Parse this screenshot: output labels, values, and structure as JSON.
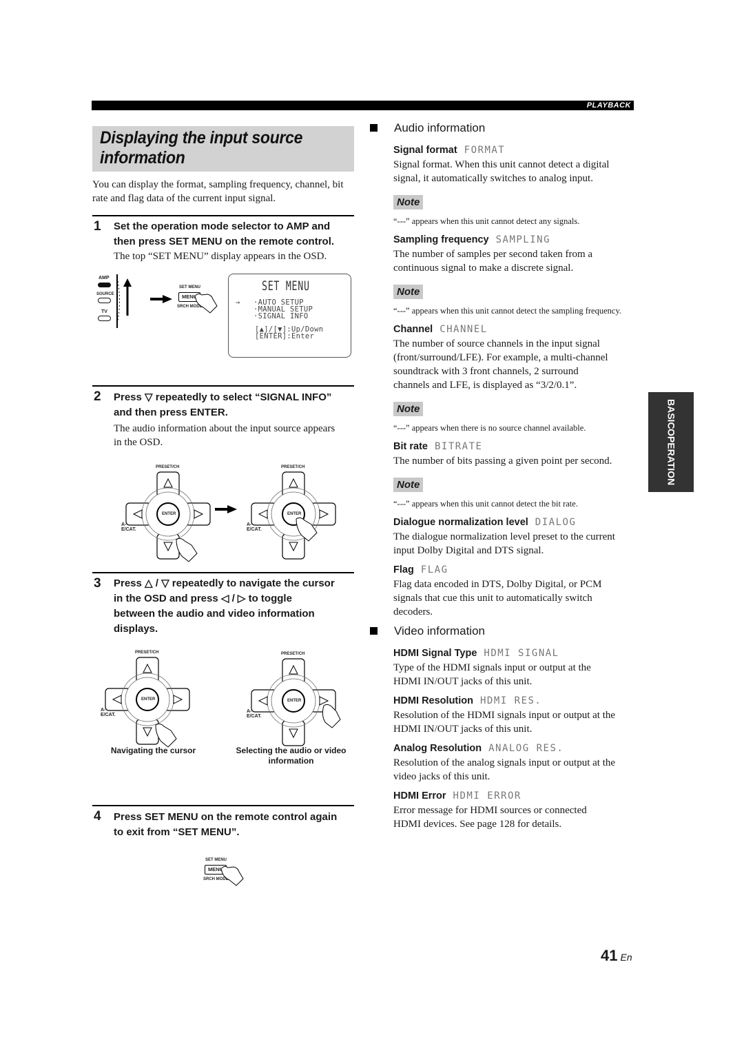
{
  "header": {
    "section_tag": "PLAYBACK"
  },
  "left": {
    "title_line1": "Displaying the input source",
    "title_line2": "information",
    "intro": "You can display the format, sampling frequency, channel, bit rate and flag data of the current input signal.",
    "steps": [
      {
        "num": "1",
        "head_lines": [
          "Set the operation mode selector to AMP and",
          "then press SET MENU on the remote control."
        ],
        "desc_lines": [
          "The top “SET MENU” display appears in the OSD."
        ]
      },
      {
        "num": "2",
        "head_lines": [
          "Press ▽ repeatedly to select “SIGNAL INFO”",
          "and then press ENTER."
        ],
        "desc_lines": [
          "The audio information about the input source appears",
          "in the OSD."
        ]
      },
      {
        "num": "3",
        "head_lines": [
          "Press △ / ▽ repeatedly to navigate the cursor",
          "in the OSD and press ◁ / ▷ to toggle",
          "between the audio and video information",
          "displays."
        ],
        "desc_lines": []
      },
      {
        "num": "4",
        "head_lines": [
          "Press SET MENU on the remote control again",
          "to exit from “SET MENU”."
        ],
        "desc_lines": []
      }
    ],
    "remote": {
      "selector_labels": [
        "AMP",
        "SOURCE",
        "TV"
      ],
      "set_menu_label": "SET MENU",
      "menu_button": "MENU",
      "srch_mode_label": "SRCH MODE",
      "preset_label": "PRESET/CH",
      "enter_label": "ENTER",
      "ae_cat_label": "A-E/CAT."
    },
    "osd": {
      "title": "SET MENU",
      "cursor": "→",
      "items": [
        "·AUTO SETUP",
        "·MANUAL SETUP",
        "·SIGNAL INFO"
      ],
      "help": [
        "[▲]/[▼]:Up/Down",
        "[ENTER]:Enter"
      ]
    },
    "captions": [
      "Navigating the cursor",
      "Selecting the audio or video information"
    ]
  },
  "right": {
    "audio_heading": "Audio information",
    "audio_items": [
      {
        "label": "Signal format",
        "lcd": "FORMAT",
        "desc_lines": [
          "Signal format. When this unit cannot detect a digital",
          "signal, it automatically switches to analog input."
        ],
        "note": "“---” appears when this unit cannot detect any signals."
      },
      {
        "label": "Sampling frequency",
        "lcd": "SAMPLING",
        "desc_lines": [
          "The number of samples per second taken from a",
          "continuous signal to make a discrete signal."
        ],
        "note": "“---” appears when this unit cannot detect the sampling frequency."
      },
      {
        "label": "Channel",
        "lcd": "CHANNEL",
        "desc_lines": [
          "The number of source channels in the input signal",
          "(front/surround/LFE). For example, a multi-channel",
          "soundtrack with 3 front channels, 2 surround",
          "channels and LFE, is displayed as “3/2/0.1”."
        ],
        "note": "“---” appears when there is no source channel available."
      },
      {
        "label": "Bit rate",
        "lcd": "BITRATE",
        "desc_lines": [
          "The number of bits passing a given point per second."
        ],
        "note": "“---” appears when this unit cannot detect the bit rate."
      },
      {
        "label": "Dialogue normalization level",
        "lcd": "DIALOG",
        "desc_lines": [
          "The dialogue normalization level preset to the current",
          "input Dolby Digital and DTS signal."
        ]
      },
      {
        "label": "Flag",
        "lcd": "FLAG",
        "desc_lines": [
          "Flag data encoded in DTS, Dolby Digital, or PCM",
          "signals that cue this unit to automatically switch",
          "decoders."
        ]
      }
    ],
    "note_label": "Note",
    "video_heading": "Video information",
    "video_items": [
      {
        "label": "HDMI Signal Type",
        "lcd": "HDMI SIGNAL",
        "desc_lines": [
          "Type of the HDMI signals input or output at the",
          "HDMI IN/OUT jacks of this unit."
        ]
      },
      {
        "label": "HDMI Resolution",
        "lcd": "HDMI RES.",
        "desc_lines": [
          "Resolution of the HDMI signals input or output at the",
          "HDMI IN/OUT jacks of this unit."
        ]
      },
      {
        "label": "Analog Resolution",
        "lcd": "ANALOG RES.",
        "desc_lines": [
          "Resolution of the analog signals input or output at the",
          "video jacks of this unit."
        ]
      },
      {
        "label": "HDMI Error",
        "lcd": "HDMI ERROR",
        "desc_lines": [
          "Error message for HDMI sources or connected",
          "HDMI devices. See page 128 for details."
        ]
      }
    ]
  },
  "side_tab": {
    "line1": "BASIC",
    "line2": "OPERATION"
  },
  "footer": {
    "page": "41",
    "lang": "En"
  }
}
